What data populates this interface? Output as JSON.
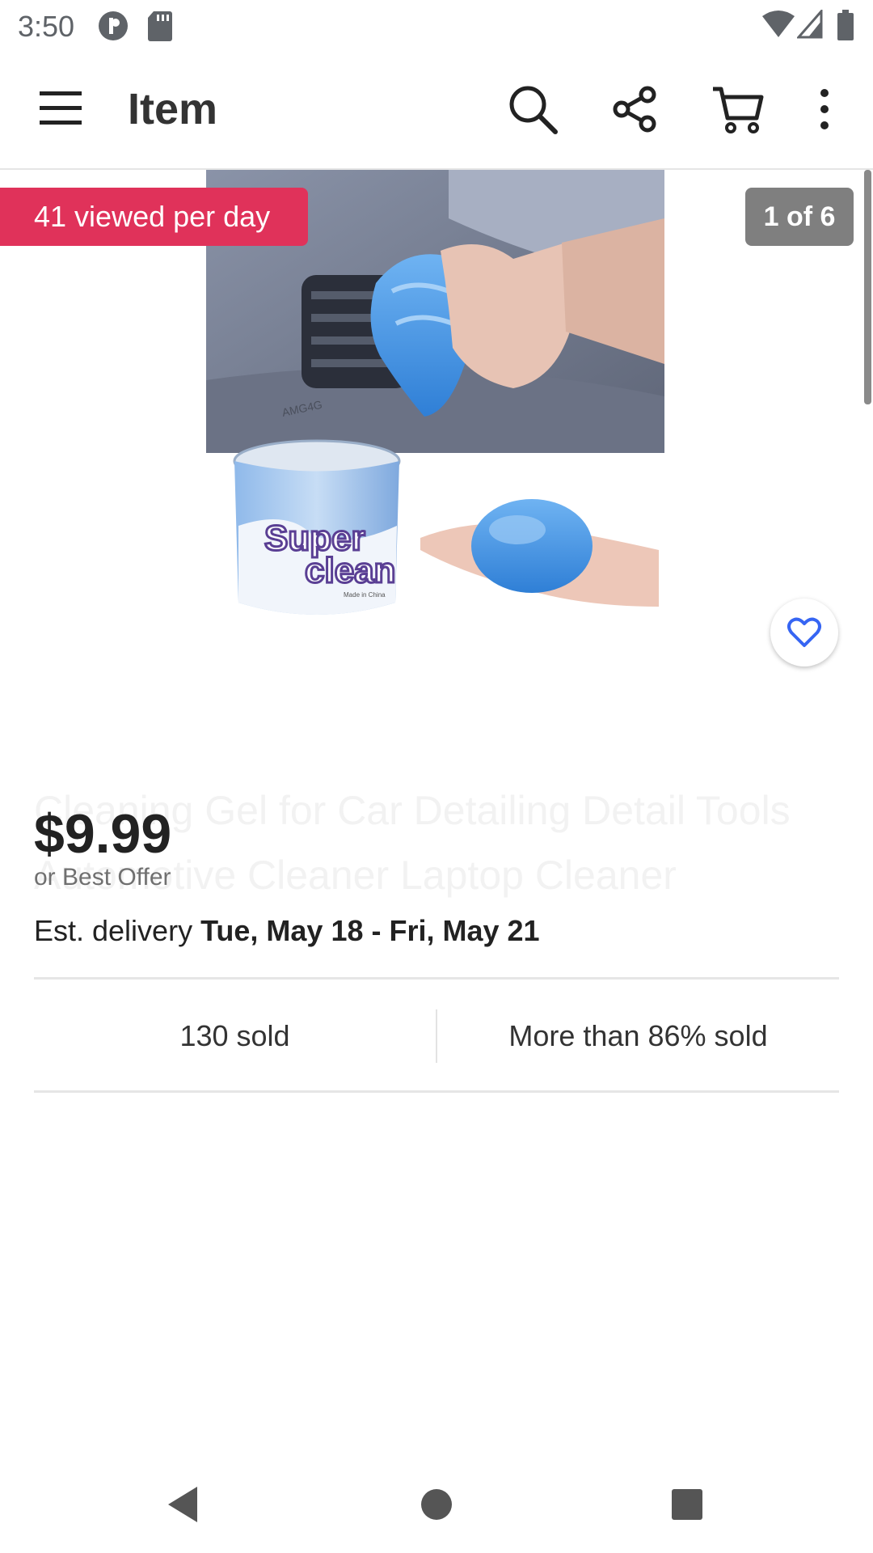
{
  "status_bar": {
    "time": "3:50",
    "icons": [
      "app-notification-icon",
      "sd-card-icon",
      "wifi-icon",
      "signal-icon",
      "battery-icon"
    ]
  },
  "app_bar": {
    "title": "Item",
    "icons": [
      "menu-icon",
      "search-icon",
      "share-icon",
      "cart-icon",
      "more-vert-icon"
    ]
  },
  "gallery": {
    "viewed_badge": "41 viewed per day",
    "counter": "1 of 6",
    "image_label_top": "Super",
    "image_label_bottom": "clean",
    "jar_fine_print": "Made in China",
    "dash_text": "AMG4G"
  },
  "listing": {
    "ghost_title": "Cleaning Gel for Car Detailing Detail Tools Automotive Cleaner Laptop Cleaner",
    "price": "$9.99",
    "offer": "or Best Offer",
    "delivery_prefix": "Est. delivery ",
    "delivery_dates": "Tue, May 18 - Fri, May 21"
  },
  "stats": {
    "sold": "130 sold",
    "percent_sold": "More than 86% sold"
  },
  "colors": {
    "badge_red": "#e0325a",
    "counter_gray": "#7f7f7f",
    "watch_blue": "#3665f3"
  }
}
